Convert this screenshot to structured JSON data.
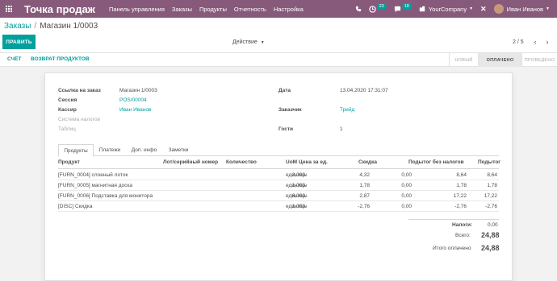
{
  "topbar": {
    "app_title": "Точка продаж",
    "menu": [
      "Панель управления",
      "Заказы",
      "Продукты",
      "Отчетность",
      "Настройка"
    ],
    "activity_count": "23",
    "messages_count": "18",
    "company": "YourCompany",
    "user": "Иван Иванов",
    "colors": {
      "brand": "#875a7b",
      "accent": "#00a09d"
    }
  },
  "breadcrumb": {
    "parent": "Заказы",
    "separator": "/",
    "current": "Магазин 1/0003"
  },
  "toolbar": {
    "edit_label": "ПРАВИТЬ",
    "action_label": "Действие",
    "pager": "2 / 5"
  },
  "statusbar": {
    "buttons": [
      "СЧЁТ",
      "ВОЗВРАТ ПРОДУКТОВ"
    ],
    "stages": [
      "НОВЫЙ",
      "ОПЛАЧЕНО",
      "ПРОВЕДЕНО"
    ],
    "active_stage": "ОПЛАЧЕНО"
  },
  "form": {
    "order_ref_label": "Ссылка на заказ",
    "order_ref": "Магазин 1/0003",
    "session_label": "Сессия",
    "session": "POS/00004",
    "cashier_label": "Кассир",
    "cashier": "Иван Иванов",
    "fiscal_label": "Система налогов",
    "table_label": "Таблиц",
    "date_label": "Дата",
    "date": "13.04.2020 17:31:07",
    "customer_label": "Заказчик",
    "customer": "Трейд",
    "guests_label": "Гости",
    "guests": "1"
  },
  "tabs": [
    "Продукты",
    "Платежи",
    "Доп. инфо",
    "Заметки"
  ],
  "table": {
    "headers": {
      "product": "Продукт",
      "lot": "Лот/серийный номер",
      "qty": "Количество",
      "uom": "UoM",
      "price": "Цена за ед.",
      "discount": "Скидка",
      "subtotal_excl": "Подытог без налогов",
      "subtotal": "Подытог"
    },
    "rows": [
      {
        "product": "[FURN_0004] слоеный лоток",
        "qty": "2,000",
        "uom": "единицы",
        "price": "4,32",
        "discount": "0,00",
        "subtotal_excl": "8,64",
        "subtotal": "8,64"
      },
      {
        "product": "[FURN_0005] магнитная доска",
        "qty": "1,000",
        "uom": "единицы",
        "price": "1,78",
        "discount": "0,00",
        "subtotal_excl": "1,78",
        "subtotal": "1,78"
      },
      {
        "product": "[FURN_0006] Подставка для монитора",
        "qty": "6,000",
        "uom": "единицы",
        "price": "2,87",
        "discount": "0,00",
        "subtotal_excl": "17,22",
        "subtotal": "17,22"
      },
      {
        "product": "[DISC] Скидка",
        "qty": "1,000",
        "uom": "единицы",
        "price": "-2,76",
        "discount": "0,00",
        "subtotal_excl": "-2,76",
        "subtotal": "-2,76"
      }
    ]
  },
  "totals": {
    "taxes_label": "Налоги:",
    "taxes": "0,00",
    "total_label": "Всего:",
    "total": "24,88",
    "paid_label": "Итого оплачено",
    "paid": "24,88"
  }
}
